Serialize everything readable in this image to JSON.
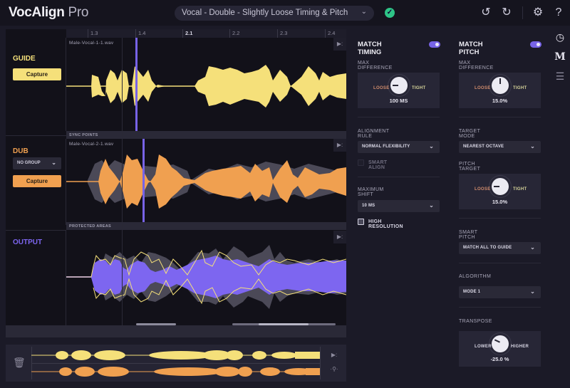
{
  "app": {
    "name": "VocAlign",
    "edition": "Pro"
  },
  "toolbar": {
    "preset": "Vocal - Double - Slightly Loose Timing & Pitch",
    "status_icon": "check-circle-icon",
    "undo_icon": "undo-icon",
    "redo_icon": "redo-icon",
    "settings_icon": "gear-icon",
    "help_label": "?"
  },
  "colors": {
    "guide": "#f5e07a",
    "dub": "#f0a050",
    "output": "#7d66f0",
    "accent": "#7763e6",
    "status_ok": "#2ec487"
  },
  "ruler": {
    "ticks": [
      "1.3",
      "1.4",
      "2.1",
      "2.2",
      "2.3",
      "2.4"
    ],
    "major": [
      "2.1"
    ]
  },
  "tracks": {
    "guide": {
      "label": "GUIDE",
      "file": "Male-Vocal-1-1.wav",
      "capture": "Capture"
    },
    "sync_points": "SYNC POINTS",
    "dub": {
      "label": "DUB",
      "file": "Male-Vocal-2-1.wav",
      "group": "NO GROUP",
      "capture": "Capture"
    },
    "protected_areas": "PROTECTED AREAS",
    "output": {
      "label": "OUTPUT"
    }
  },
  "match_timing": {
    "title": "MATCH TIMING",
    "enabled": true,
    "max_difference": {
      "label": "MAX DIFFERENCE",
      "lo": "LOOSE",
      "hi": "TIGHT",
      "value": "100 MS"
    },
    "alignment_rule": {
      "label": "ALIGNMENT RULE",
      "value": "NORMAL FLEXIBILITY"
    },
    "smart_align": {
      "label": "SMART ALIGN",
      "checked": false,
      "enabled": false
    },
    "maximum_shift": {
      "label": "MAXIMUM SHIFT",
      "value": "10 MS"
    },
    "high_resolution": {
      "label": "HIGH RESOLUTION",
      "checked": true
    }
  },
  "match_pitch": {
    "title": "MATCH PITCH",
    "enabled": true,
    "max_difference": {
      "label": "MAX DIFFERENCE",
      "lo": "LOOSE",
      "hi": "TIGHT",
      "value": "15.0%"
    },
    "target_mode": {
      "label": "TARGET MODE",
      "value": "NEAREST OCTAVE"
    },
    "pitch_target": {
      "label": "PITCH TARGET",
      "lo": "LOOSE",
      "hi": "TIGHT",
      "value": "15.0%"
    },
    "smart_pitch": {
      "label": "SMART PITCH",
      "value": "MATCH ALL TO GUIDE"
    },
    "algorithm": {
      "label": "ALGORITHM",
      "value": "MODE 1"
    },
    "transpose": {
      "label": "TRANSPOSE",
      "lo": "LOWER",
      "hi": "HIGHER",
      "value": "-25.0 %"
    }
  },
  "sidebar": {
    "items": [
      "clock-icon",
      "waveform-m-icon",
      "sliders-icon"
    ]
  }
}
